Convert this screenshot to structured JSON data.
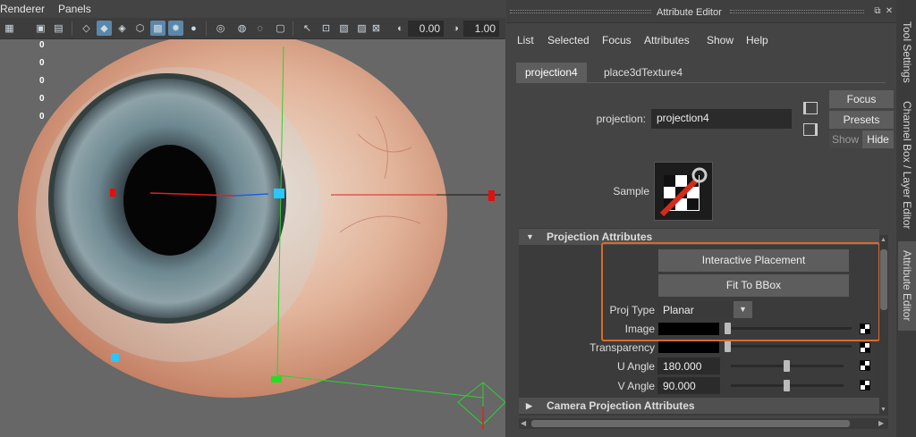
{
  "viewport": {
    "menu": [
      "Renderer",
      "Panels"
    ],
    "toolbar_values": [
      "0.00",
      "1.00"
    ],
    "hud_values": [
      "0",
      "0",
      "0",
      "0",
      "0"
    ]
  },
  "attribute_editor": {
    "title": "Attribute Editor",
    "menu": [
      "List",
      "Selected",
      "Focus",
      "Attributes",
      "Show",
      "Help"
    ],
    "tabs": [
      "projection4",
      "place3dTexture4"
    ],
    "node_label": "projection:",
    "node_name": "projection4",
    "buttons": {
      "focus": "Focus",
      "presets": "Presets",
      "show": "Show",
      "hide": "Hide"
    },
    "sample_label": "Sample",
    "sections": {
      "projection": "Projection Attributes",
      "camera": "Camera Projection Attributes"
    },
    "actions": {
      "interactive_placement": "Interactive Placement",
      "fit_to_bbox": "Fit To BBox"
    },
    "proj_type": {
      "label": "Proj Type",
      "value": "Planar"
    },
    "image": {
      "label": "Image"
    },
    "transparency": {
      "label": "Transparency"
    },
    "u_angle": {
      "label": "U Angle",
      "value": "180.000"
    },
    "v_angle": {
      "label": "V Angle",
      "value": "90.000"
    }
  },
  "side_tabs": [
    "Tool Settings",
    "Channel Box / Layer Editor",
    "Attribute Editor"
  ],
  "colors": {
    "accent_highlight": "#d86b2e",
    "toolbar_active": "#5a87ab",
    "panel_bg": "#444444"
  }
}
